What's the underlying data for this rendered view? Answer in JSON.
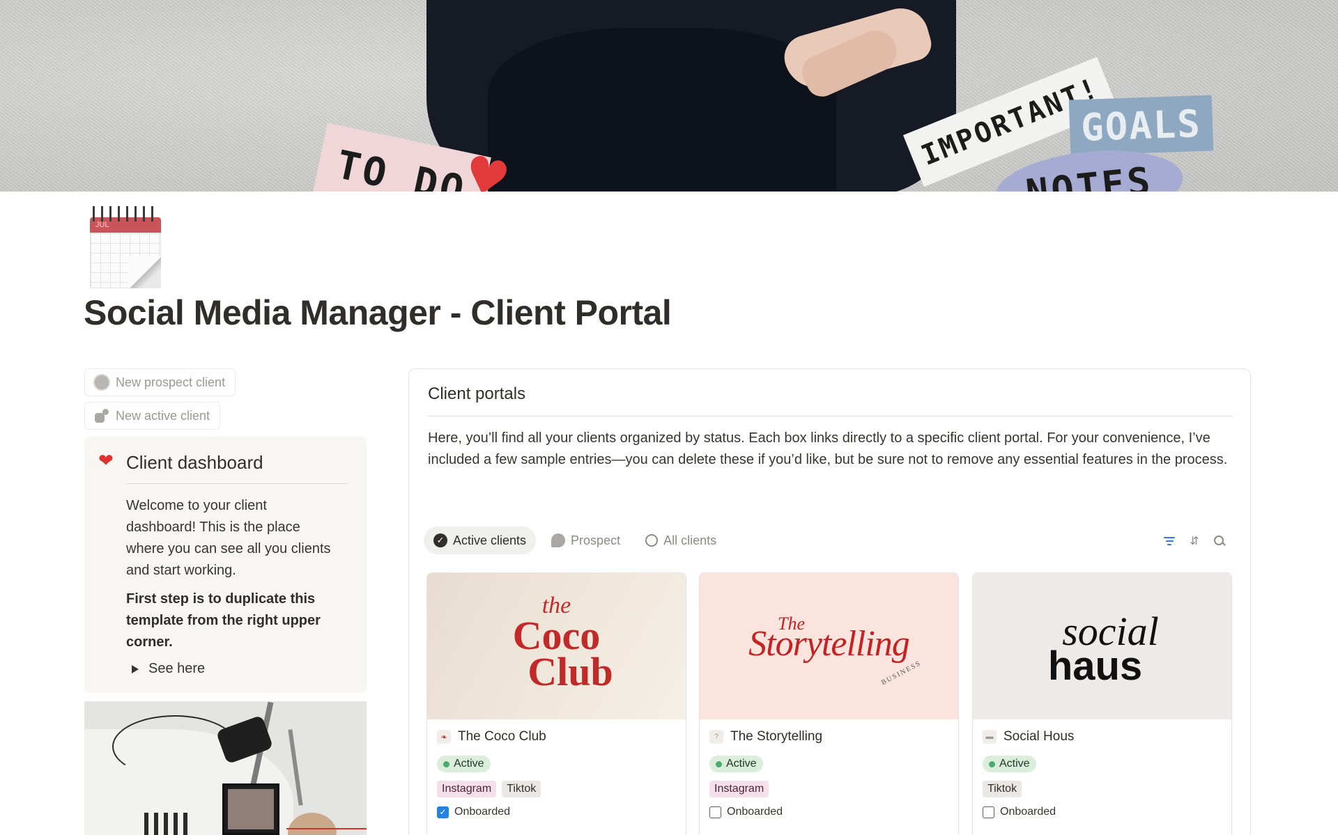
{
  "cover": {
    "stickers": {
      "todo": "TO DO",
      "important": "IMPORTANT!",
      "goals": "GOALS",
      "notes": "NOTES"
    },
    "heart_color": "#e23a3a"
  },
  "page_icon": {
    "month": "JUL",
    "icon": "calendar-icon"
  },
  "page": {
    "title": "Social Media Manager - Client Portal"
  },
  "sidebar": {
    "new_prospect_label": "New prospect client",
    "new_active_label": "New active client",
    "callout": {
      "icon": "heart-icon",
      "title": "Client dashboard",
      "body": "Welcome to your client dashboard! This is the place where you can see all you clients and start working.",
      "bold": "First step is to duplicate this template from the right upper corner.",
      "toggle_label": "See here"
    }
  },
  "portal": {
    "title": "Client portals",
    "description": "Here, you’ll find all your clients organized by status. Each box links directly to a specific client portal. For your convenience, I’ve included a few sample entries—you can delete these if you’d like, but be sure not to remove any essential features in the process.",
    "tabs": [
      {
        "label": "Active clients",
        "icon": "verified-check-icon",
        "active": true
      },
      {
        "label": "Prospect",
        "icon": "chat-bubble-icon",
        "active": false
      },
      {
        "label": "All clients",
        "icon": "circle-icon",
        "active": false
      }
    ],
    "accent_color": "#2e7bd6",
    "cards": [
      {
        "name": "The Coco Club",
        "logo_lines": [
          "the",
          "Coco",
          "Club"
        ],
        "status": "Active",
        "tags": [
          {
            "label": "Instagram",
            "color": "pink"
          },
          {
            "label": "Tiktok",
            "color": "gray"
          }
        ],
        "onboarded_label": "Onboarded",
        "onboarded": true
      },
      {
        "name": "The Storytelling",
        "logo_lines": [
          "The",
          "Storytelling",
          "BUSINESS"
        ],
        "status": "Active",
        "tags": [
          {
            "label": "Instagram",
            "color": "pink"
          }
        ],
        "onboarded_label": "Onboarded",
        "onboarded": false
      },
      {
        "name": "Social Hous",
        "logo_lines": [
          "social",
          "haus"
        ],
        "status": "Active",
        "tags": [
          {
            "label": "Tiktok",
            "color": "gray"
          }
        ],
        "onboarded_label": "Onboarded",
        "onboarded": false
      }
    ],
    "status_color": "#4dab6f",
    "checkbox_color": "#2383e2"
  }
}
